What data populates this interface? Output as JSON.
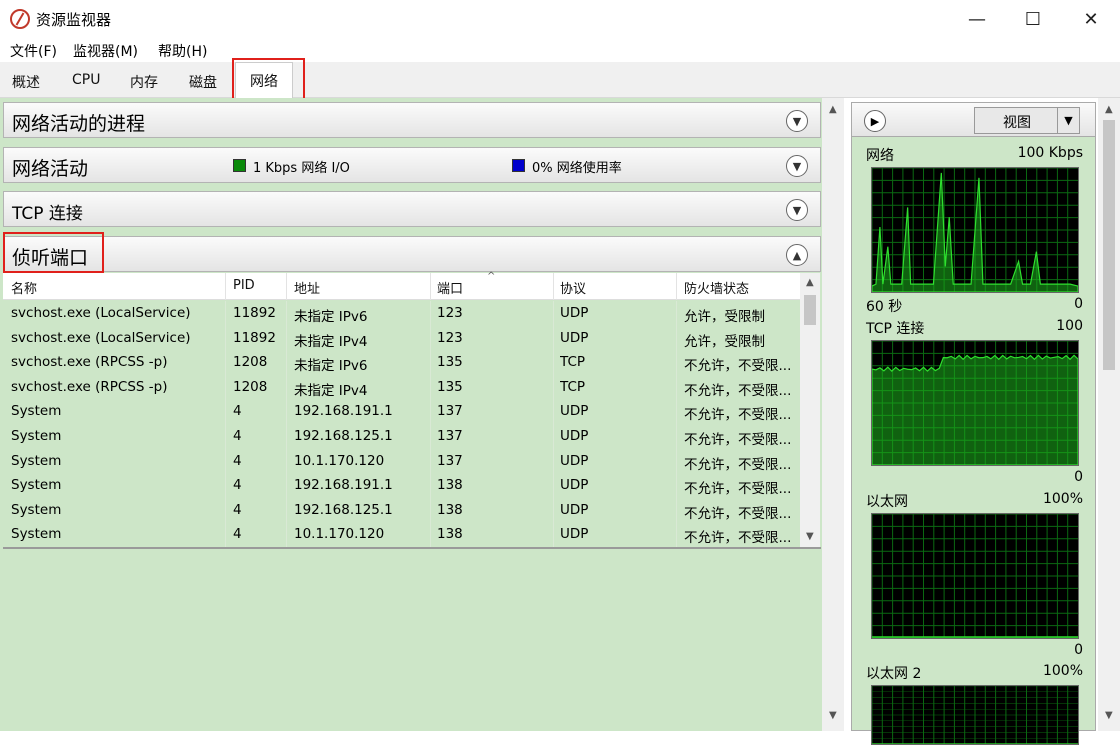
{
  "window": {
    "title": "资源监视器",
    "minimize": "—",
    "maximize": "☐",
    "close": "✕"
  },
  "menu": [
    "文件(F)",
    "监视器(M)",
    "帮助(H)"
  ],
  "tabs": [
    "概述",
    "CPU",
    "内存",
    "磁盘",
    "网络"
  ],
  "active_tab": "网络",
  "sections": {
    "processes": "网络活动的进程",
    "activity": "网络活动",
    "activity_io": "1 Kbps 网络 I/O",
    "activity_usage": "0% 网络使用率",
    "tcp": "TCP 连接",
    "listening": "侦听端口"
  },
  "colors": {
    "io": "#0a8a0a",
    "usage": "#0000cc",
    "graph_line": "#2fe02f",
    "graph_fill": "#1db31d",
    "highlight": "#e0201b"
  },
  "table": {
    "headers": [
      "名称",
      "PID",
      "地址",
      "端口",
      "协议",
      "防火墙状态"
    ],
    "rows": [
      [
        "svchost.exe (LocalService)",
        "11892",
        "未指定 IPv6",
        "123",
        "UDP",
        "允许，受限制"
      ],
      [
        "svchost.exe (LocalService)",
        "11892",
        "未指定 IPv4",
        "123",
        "UDP",
        "允许，受限制"
      ],
      [
        "svchost.exe (RPCSS -p)",
        "1208",
        "未指定 IPv6",
        "135",
        "TCP",
        "不允许，不受限..."
      ],
      [
        "svchost.exe (RPCSS -p)",
        "1208",
        "未指定 IPv4",
        "135",
        "TCP",
        "不允许，不受限..."
      ],
      [
        "System",
        "4",
        "192.168.191.1",
        "137",
        "UDP",
        "不允许，不受限..."
      ],
      [
        "System",
        "4",
        "192.168.125.1",
        "137",
        "UDP",
        "不允许，不受限..."
      ],
      [
        "System",
        "4",
        "10.1.170.120",
        "137",
        "UDP",
        "不允许，不受限..."
      ],
      [
        "System",
        "4",
        "192.168.191.1",
        "138",
        "UDP",
        "不允许，不受限..."
      ],
      [
        "System",
        "4",
        "192.168.125.1",
        "138",
        "UDP",
        "不允许，不受限..."
      ],
      [
        "System",
        "4",
        "10.1.170.120",
        "138",
        "UDP",
        "不允许，不受限..."
      ]
    ]
  },
  "right_panel": {
    "view_label": "视图",
    "graphs": [
      {
        "title": "网络",
        "max": "100 Kbps",
        "footer_left": "60 秒",
        "footer_right": "0"
      },
      {
        "title": "TCP 连接",
        "max": "100",
        "footer_left": "",
        "footer_right": "0"
      },
      {
        "title": "以太网",
        "max": "100%",
        "footer_left": "",
        "footer_right": "0"
      },
      {
        "title": "以太网 2",
        "max": "100%",
        "footer_left": "",
        "footer_right": ""
      }
    ],
    "tcp_level": 0.9
  }
}
